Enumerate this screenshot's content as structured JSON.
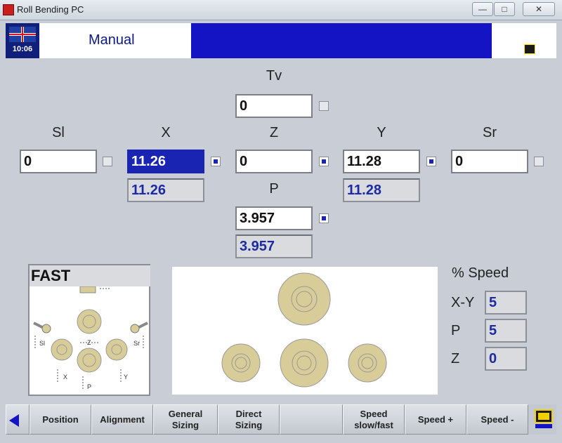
{
  "window": {
    "title": "Roll Bending PC",
    "buttons": {
      "minimize": "—",
      "maximize": "□",
      "close": "✕"
    }
  },
  "header": {
    "clock": "10:06",
    "mode": "Manual",
    "flag_icon": "uk-flag-icon"
  },
  "axes": {
    "tv": {
      "label": "Tv",
      "value": "0"
    },
    "sl": {
      "label": "Sl",
      "value": "0"
    },
    "x": {
      "label": "X",
      "value": "11.26",
      "readout": "11.26"
    },
    "z": {
      "label": "Z",
      "value": "0"
    },
    "y": {
      "label": "Y",
      "value": "11.28",
      "readout": "11.28"
    },
    "sr": {
      "label": "Sr",
      "value": "0"
    },
    "p": {
      "label": "P",
      "value": "3.957",
      "readout": "3.957"
    }
  },
  "diagram": {
    "mode_label": "FAST",
    "labels": {
      "sl": "Sl",
      "sr": "Sr",
      "z": "Z",
      "x": "X",
      "y": "Y",
      "p": "P"
    }
  },
  "speed": {
    "title": "% Speed",
    "rows": [
      {
        "label": "X-Y",
        "value": "5"
      },
      {
        "label": "P",
        "value": "5"
      },
      {
        "label": "Z",
        "value": "0"
      }
    ]
  },
  "toolbar": {
    "buttons": [
      {
        "label": "Position"
      },
      {
        "label": "Alignment"
      },
      {
        "label": "General\nSizing"
      },
      {
        "label": "Direct\nSizing"
      },
      {
        "label": ""
      },
      {
        "label": "Speed\nslow/fast"
      },
      {
        "label": "Speed +"
      },
      {
        "label": "Speed -"
      }
    ]
  },
  "colors": {
    "accent": "#1414c4",
    "readout_text": "#1c2aa4",
    "roll_fill": "#d8cc98"
  }
}
